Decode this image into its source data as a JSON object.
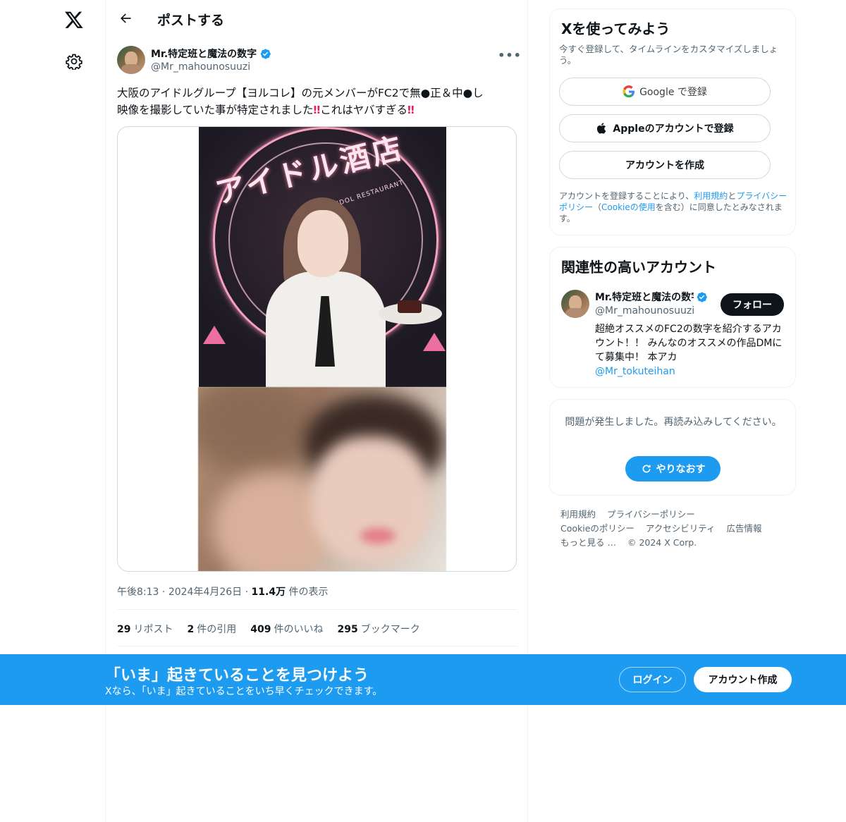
{
  "header": {
    "title": "ポストする"
  },
  "post": {
    "author_name": "Mr.特定班と魔法の数字",
    "author_handle": "@Mr_mahounosuuzi",
    "more_label": "•••",
    "text_line1": "大阪のアイドルグループ【ヨルコレ】の元メンバーがFC2で無●正＆中●し",
    "text_line2a": "映像を撮影していた事が特定されました",
    "text_line2b": "これはヤバすぎる",
    "bang": "‼",
    "image_sign_text": "アイドル酒店",
    "image_sign_sub": "JAPANESE IDOL RESTAURANT",
    "time": "午後8:13",
    "sep": "·",
    "date": "2024年4月26日",
    "views_count": "11.4万",
    "views_label": "件の表示",
    "stats": [
      {
        "count": "29",
        "label": "リポスト"
      },
      {
        "count": "2",
        "label": "件の引用"
      },
      {
        "count": "409",
        "label": "件のいいね"
      },
      {
        "count": "295",
        "label": "ブックマーク"
      }
    ]
  },
  "signup": {
    "title": "Xを使ってみよう",
    "subtitle": "今すぐ登録して、タイムラインをカスタマイズしましょう。",
    "google_label": "Google で登録",
    "apple_label": "Appleのアカウントで登録",
    "create_label": "アカウントを作成",
    "terms_prefix": "アカウントを登録することにより、",
    "terms_link1": "利用規約",
    "terms_and": "と",
    "terms_link2": "プライバシーポリシー",
    "terms_paren_open": "（",
    "terms_link3": "Cookieの使用",
    "terms_suffix": "を含む）に同意したとみなされます。"
  },
  "related": {
    "title": "関連性の高いアカウント",
    "name": "Mr.特定班と魔法の数字",
    "handle": "@Mr_mahounosuuzi",
    "follow_label": "フォロー",
    "bio": "超絶オススメのFC2の数字を紹介するアカウント！！ みんなのオススメの作品DMにて募集中！ 本アカ",
    "bio_mention": "@Mr_tokuteihan"
  },
  "error": {
    "message": "問題が発生しました。再読み込みしてください。",
    "retry_label": "やりなおす"
  },
  "footer": {
    "links": [
      "利用規約",
      "プライバシーポリシー",
      "Cookieのポリシー",
      "アクセシビリティ",
      "広告情報",
      "もっと見る …"
    ],
    "copyright": "© 2024 X Corp."
  },
  "banner": {
    "title": "「いま」起きていることを見つけよう",
    "subtitle": "Xなら、「いま」起きていることをいち早くチェックできます。",
    "login_label": "ログイン",
    "signup_label": "アカウント作成"
  },
  "colors": {
    "accent": "#1d9bf0",
    "text": "#0f1419",
    "muted": "#536471",
    "border": "#eff3f4"
  }
}
